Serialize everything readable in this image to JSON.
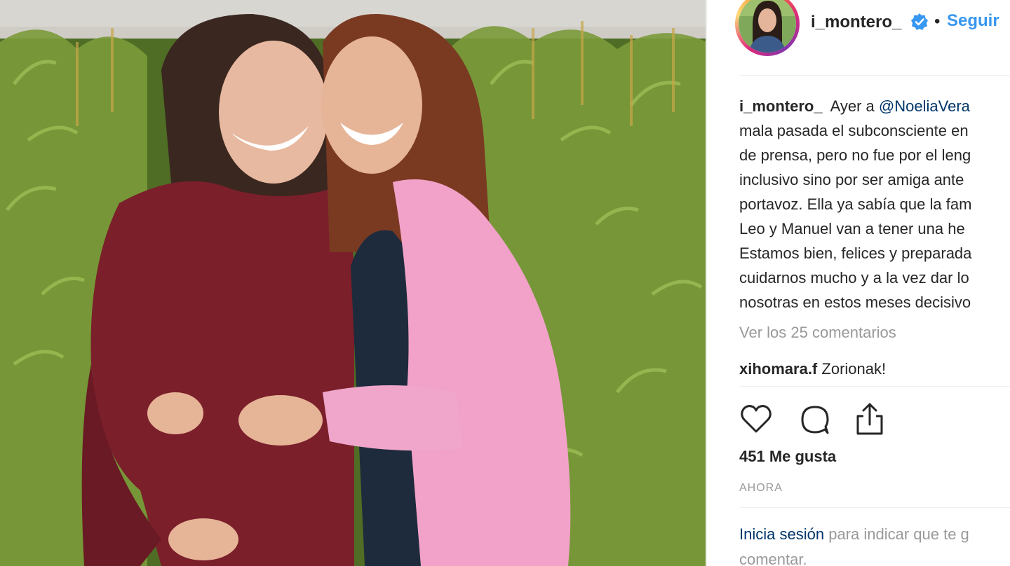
{
  "post": {
    "username": "i_montero_",
    "follow_label": "Seguir",
    "separator": "•",
    "caption": {
      "user": "i_montero_",
      "lines": [
        {
          "pre": "Ayer a ",
          "mention": "@NoeliaVera",
          "post": ""
        },
        {
          "text": "mala pasada el subconsciente en"
        },
        {
          "text": "de prensa, pero no fue por el leng"
        },
        {
          "text": "inclusivo sino por ser amiga ante"
        },
        {
          "text": "portavoz. Ella ya sabía que la fam"
        },
        {
          "text": "Leo y Manuel van a tener una he"
        },
        {
          "text": "Estamos bien, felices y preparada"
        },
        {
          "text": "cuidarnos mucho y a la vez dar lo"
        },
        {
          "text": "nosotras en estos meses decisivo"
        }
      ]
    },
    "view_comments": "Ver los 25 comentarios",
    "comment": {
      "user": "xihomara.f",
      "text": "Zorionak!"
    },
    "icons": {
      "like": "heart-icon",
      "comment": "comment-bubble-icon",
      "share": "share-icon",
      "verified": "verified-badge-icon"
    },
    "likes": "451 Me gusta",
    "time": "AHORA",
    "login": {
      "link": "Inicia sesión",
      "text": "para indicar que te g",
      "line2": "comentar."
    }
  },
  "colors": {
    "accent": "#3897f0",
    "verified": "#3897f0",
    "mention": "#003569",
    "muted": "#999999"
  }
}
